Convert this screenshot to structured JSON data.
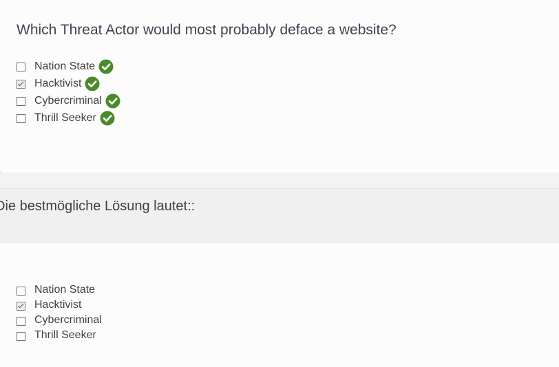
{
  "question": {
    "title": "Which Threat Actor would most probably deface a website?",
    "options": [
      {
        "label": "Nation State",
        "checked": false,
        "marked_correct": true
      },
      {
        "label": "Hacktivist",
        "checked": true,
        "marked_correct": true
      },
      {
        "label": "Cybercriminal",
        "checked": false,
        "marked_correct": true
      },
      {
        "label": "Thrill Seeker",
        "checked": false,
        "marked_correct": true
      }
    ]
  },
  "solution": {
    "heading": "Die bestmögliche Lösung lautet::",
    "options": [
      {
        "label": "Nation State",
        "checked": false
      },
      {
        "label": "Hacktivist",
        "checked": true
      },
      {
        "label": "Cybercriminal",
        "checked": false
      },
      {
        "label": "Thrill Seeker",
        "checked": false
      }
    ]
  },
  "colors": {
    "correct_icon": "#4a8a2a",
    "card_background": "#fcfcfc",
    "solution_band": "#f0f0f0"
  }
}
